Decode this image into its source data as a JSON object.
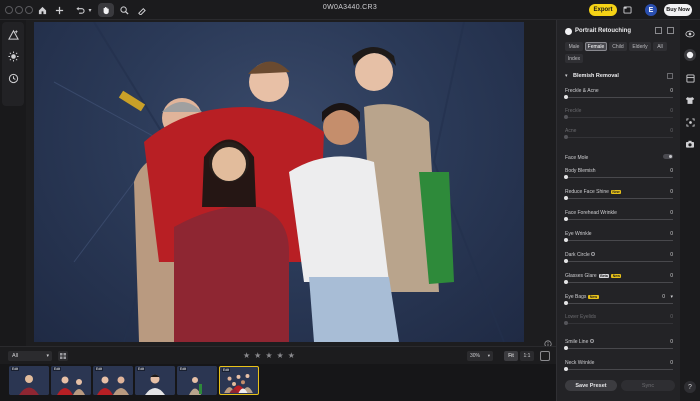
{
  "window": {
    "title": "0W0A3440.CR3"
  },
  "toolbar": {
    "export_label": "Export",
    "user_initial": "E",
    "buy_label": "Buy Now"
  },
  "panel": {
    "title": "Portrait Retouching",
    "genders": [
      "Male",
      "Female",
      "Child",
      "Elderly",
      "All",
      "Index"
    ],
    "selected_gender": "Female",
    "section_title": "Blemish Removal",
    "sliders": [
      {
        "label": "Freckle & Acne",
        "value": "0",
        "enabled": true
      },
      {
        "label": "Freckle",
        "value": "0",
        "enabled": false
      },
      {
        "label": "Acne",
        "value": "0",
        "enabled": false
      },
      {
        "label": "Face Mole",
        "value": "",
        "enabled": true,
        "toggle": true
      },
      {
        "label": "Body Blemish",
        "value": "0",
        "enabled": true
      },
      {
        "label": "Reduce Face Shine",
        "value": "0",
        "enabled": true,
        "badge": "New"
      },
      {
        "label": "Face Forehead Wrinkle",
        "value": "0",
        "enabled": true
      },
      {
        "label": "Eye Wrinkle",
        "value": "0",
        "enabled": true
      },
      {
        "label": "Dark Circle",
        "value": "0",
        "enabled": true,
        "info": true
      },
      {
        "label": "Glasses Glare",
        "value": "0",
        "enabled": true,
        "badge": "Beta",
        "badge2": "New"
      },
      {
        "label": "Eye Bags",
        "value": "0",
        "enabled": true,
        "badge": "New"
      },
      {
        "label": "Lower Eyelids",
        "value": "0",
        "enabled": false
      },
      {
        "label": "Smile Line",
        "value": "0",
        "enabled": true,
        "info": true
      },
      {
        "label": "Neck Wrinkle",
        "value": "0",
        "enabled": true
      }
    ],
    "save_preset_label": "Save Preset",
    "sync_label": "Sync"
  },
  "filmbar": {
    "filter_value": "All",
    "zoom_value": "30%",
    "fit_label": "Fit",
    "one_label": "1:1",
    "thumb_tag": "Edit"
  },
  "colors": {
    "accent": "#f5d316",
    "avatar": "#2a4fb0",
    "background": "#1a1a1c"
  }
}
